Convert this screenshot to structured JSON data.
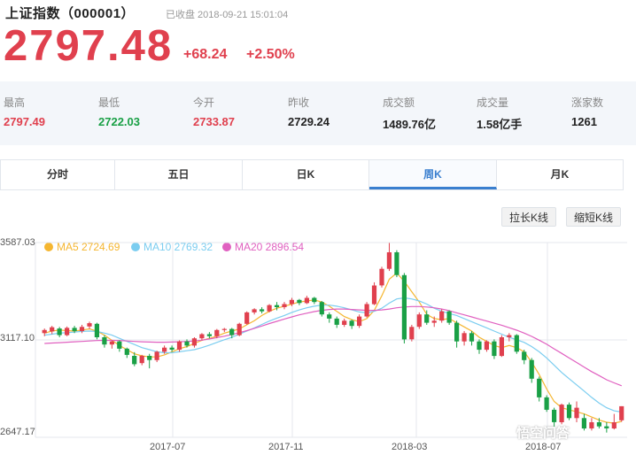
{
  "header": {
    "title": "上证指数（000001）",
    "status": "已收盘 2018-09-21 15:01:04",
    "price": "2797.48",
    "change": "+68.24",
    "change_pct": "+2.50%"
  },
  "colors": {
    "up": "#e0404e",
    "down": "#1aa046",
    "accent": "#3a7fcf"
  },
  "stats": [
    {
      "label": "最高",
      "value": "2797.49",
      "tone": "up"
    },
    {
      "label": "最低",
      "value": "2722.03",
      "tone": "down"
    },
    {
      "label": "今开",
      "value": "2733.87",
      "tone": "up"
    },
    {
      "label": "昨收",
      "value": "2729.24",
      "tone": "neutral"
    },
    {
      "label": "成交额",
      "value": "1489.76亿",
      "tone": "neutral"
    },
    {
      "label": "成交量",
      "value": "1.58亿手",
      "tone": "neutral"
    },
    {
      "label": "涨家数",
      "value": "1261",
      "tone": "neutral"
    }
  ],
  "tabs": [
    {
      "label": "分时"
    },
    {
      "label": "五日"
    },
    {
      "label": "日K"
    },
    {
      "label": "周K",
      "active": true
    },
    {
      "label": "月K"
    }
  ],
  "buttons": {
    "lengthen": "拉长K线",
    "shorten": "缩短K线"
  },
  "legend": [
    {
      "name": "MA5 2724.69",
      "color": "#f5b630"
    },
    {
      "name": "MA10 2769.32",
      "color": "#7bcdf0"
    },
    {
      "name": "MA20 2896.54",
      "color": "#e060c0"
    }
  ],
  "watermark": "悟空问答",
  "chart_data": {
    "type": "candlestick",
    "y_ticks": [
      "3587.03",
      "3117.10",
      "2647.17"
    ],
    "y_range": [
      2647.17,
      3587.03
    ],
    "x_ticks": [
      "2017-07",
      "2017-11",
      "2018-03",
      "2018-07"
    ],
    "candles": [
      [
        3150,
        3165,
        3135,
        3172
      ],
      [
        3158,
        3178,
        3145,
        3185
      ],
      [
        3172,
        3140,
        3130,
        3180
      ],
      [
        3140,
        3175,
        3135,
        3182
      ],
      [
        3175,
        3160,
        3150,
        3185
      ],
      [
        3160,
        3180,
        3150,
        3190
      ],
      [
        3182,
        3198,
        3170,
        3205
      ],
      [
        3195,
        3130,
        3120,
        3200
      ],
      [
        3130,
        3095,
        3080,
        3140
      ],
      [
        3095,
        3110,
        3075,
        3115
      ],
      [
        3110,
        3075,
        3060,
        3115
      ],
      [
        3075,
        3045,
        3030,
        3080
      ],
      [
        3040,
        3000,
        2990,
        3058
      ],
      [
        3005,
        3040,
        2995,
        3045
      ],
      [
        3040,
        3020,
        2980,
        3050
      ],
      [
        3020,
        3060,
        3010,
        3065
      ],
      [
        3060,
        3080,
        3050,
        3090
      ],
      [
        3080,
        3070,
        3060,
        3090
      ],
      [
        3070,
        3110,
        3060,
        3115
      ],
      [
        3110,
        3090,
        3080,
        3120
      ],
      [
        3090,
        3125,
        3080,
        3130
      ],
      [
        3125,
        3145,
        3115,
        3150
      ],
      [
        3145,
        3135,
        3125,
        3155
      ],
      [
        3135,
        3165,
        3125,
        3170
      ],
      [
        3165,
        3170,
        3155,
        3175
      ],
      [
        3170,
        3140,
        3125,
        3175
      ],
      [
        3140,
        3195,
        3135,
        3200
      ],
      [
        3195,
        3250,
        3190,
        3255
      ],
      [
        3250,
        3265,
        3240,
        3270
      ],
      [
        3265,
        3255,
        3245,
        3275
      ],
      [
        3255,
        3285,
        3250,
        3290
      ],
      [
        3285,
        3275,
        3260,
        3300
      ],
      [
        3275,
        3290,
        3265,
        3300
      ],
      [
        3290,
        3310,
        3280,
        3320
      ],
      [
        3310,
        3295,
        3285,
        3315
      ],
      [
        3295,
        3320,
        3290,
        3330
      ],
      [
        3320,
        3300,
        3290,
        3325
      ],
      [
        3300,
        3240,
        3230,
        3305
      ],
      [
        3240,
        3220,
        3200,
        3250
      ],
      [
        3220,
        3190,
        3175,
        3230
      ],
      [
        3190,
        3210,
        3180,
        3220
      ],
      [
        3210,
        3185,
        3170,
        3215
      ],
      [
        3185,
        3230,
        3175,
        3240
      ],
      [
        3230,
        3290,
        3225,
        3300
      ],
      [
        3290,
        3380,
        3285,
        3395
      ],
      [
        3380,
        3460,
        3370,
        3470
      ],
      [
        3460,
        3540,
        3450,
        3585
      ],
      [
        3540,
        3430,
        3420,
        3550
      ],
      [
        3430,
        3120,
        3100,
        3440
      ],
      [
        3120,
        3180,
        3110,
        3190
      ],
      [
        3180,
        3240,
        3170,
        3250
      ],
      [
        3240,
        3200,
        3190,
        3260
      ],
      [
        3200,
        3210,
        3180,
        3230
      ],
      [
        3210,
        3255,
        3200,
        3265
      ],
      [
        3255,
        3200,
        3190,
        3260
      ],
      [
        3200,
        3110,
        3080,
        3210
      ],
      [
        3110,
        3150,
        3090,
        3160
      ],
      [
        3150,
        3110,
        3090,
        3160
      ],
      [
        3110,
        3070,
        3050,
        3120
      ],
      [
        3070,
        3110,
        3060,
        3115
      ],
      [
        3110,
        3040,
        3025,
        3120
      ],
      [
        3040,
        3130,
        3035,
        3140
      ],
      [
        3130,
        3140,
        3110,
        3150
      ],
      [
        3140,
        3060,
        3050,
        3145
      ],
      [
        3060,
        3020,
        3000,
        3070
      ],
      [
        3020,
        2930,
        2910,
        3030
      ],
      [
        2930,
        2840,
        2820,
        2940
      ],
      [
        2840,
        2780,
        2770,
        2850
      ],
      [
        2780,
        2720,
        2690,
        2790
      ],
      [
        2720,
        2805,
        2710,
        2810
      ],
      [
        2805,
        2740,
        2730,
        2815
      ],
      [
        2740,
        2790,
        2720,
        2820
      ],
      [
        2740,
        2690,
        2680,
        2760
      ],
      [
        2690,
        2720,
        2680,
        2740
      ],
      [
        2720,
        2700,
        2690,
        2740
      ],
      [
        2700,
        2690,
        2670,
        2720
      ],
      [
        2690,
        2720,
        2685,
        2760
      ],
      [
        2729,
        2797,
        2722,
        2797
      ]
    ],
    "ma5": [
      3150,
      3160,
      3165,
      3162,
      3160,
      3165,
      3170,
      3160,
      3140,
      3115,
      3090,
      3070,
      3050,
      3040,
      3035,
      3035,
      3045,
      3060,
      3075,
      3085,
      3100,
      3115,
      3125,
      3135,
      3150,
      3160,
      3170,
      3190,
      3210,
      3235,
      3255,
      3270,
      3280,
      3290,
      3300,
      3305,
      3310,
      3300,
      3280,
      3255,
      3230,
      3215,
      3205,
      3220,
      3260,
      3330,
      3410,
      3440,
      3400,
      3350,
      3300,
      3240,
      3220,
      3215,
      3220,
      3200,
      3180,
      3160,
      3130,
      3110,
      3090,
      3080,
      3090,
      3080,
      3060,
      3010,
      2950,
      2880,
      2820,
      2790,
      2780,
      2770,
      2760,
      2745,
      2730,
      2720,
      2715,
      2724
    ],
    "ma10": [
      3140,
      3145,
      3150,
      3152,
      3155,
      3158,
      3160,
      3158,
      3150,
      3140,
      3125,
      3110,
      3095,
      3080,
      3070,
      3060,
      3055,
      3055,
      3060,
      3065,
      3070,
      3080,
      3092,
      3105,
      3118,
      3130,
      3145,
      3160,
      3175,
      3192,
      3208,
      3222,
      3235,
      3250,
      3262,
      3272,
      3280,
      3285,
      3285,
      3280,
      3272,
      3262,
      3252,
      3248,
      3255,
      3270,
      3295,
      3315,
      3320,
      3315,
      3305,
      3290,
      3270,
      3255,
      3245,
      3235,
      3220,
      3205,
      3190,
      3175,
      3160,
      3145,
      3130,
      3118,
      3105,
      3085,
      3060,
      3030,
      2995,
      2960,
      2930,
      2900,
      2870,
      2840,
      2812,
      2790,
      2775,
      2769
    ],
    "ma20": [
      3100,
      3102,
      3104,
      3106,
      3108,
      3110,
      3112,
      3114,
      3115,
      3115,
      3114,
      3112,
      3110,
      3108,
      3107,
      3106,
      3106,
      3107,
      3108,
      3110,
      3112,
      3116,
      3122,
      3128,
      3135,
      3143,
      3152,
      3162,
      3173,
      3184,
      3196,
      3207,
      3218,
      3228,
      3238,
      3246,
      3254,
      3260,
      3264,
      3266,
      3266,
      3264,
      3262,
      3260,
      3260,
      3262,
      3266,
      3272,
      3276,
      3278,
      3278,
      3276,
      3272,
      3266,
      3258,
      3248,
      3238,
      3228,
      3218,
      3208,
      3198,
      3188,
      3176,
      3164,
      3150,
      3134,
      3116,
      3096,
      3074,
      3052,
      3030,
      3008,
      2986,
      2964,
      2945,
      2925,
      2910,
      2896
    ]
  }
}
